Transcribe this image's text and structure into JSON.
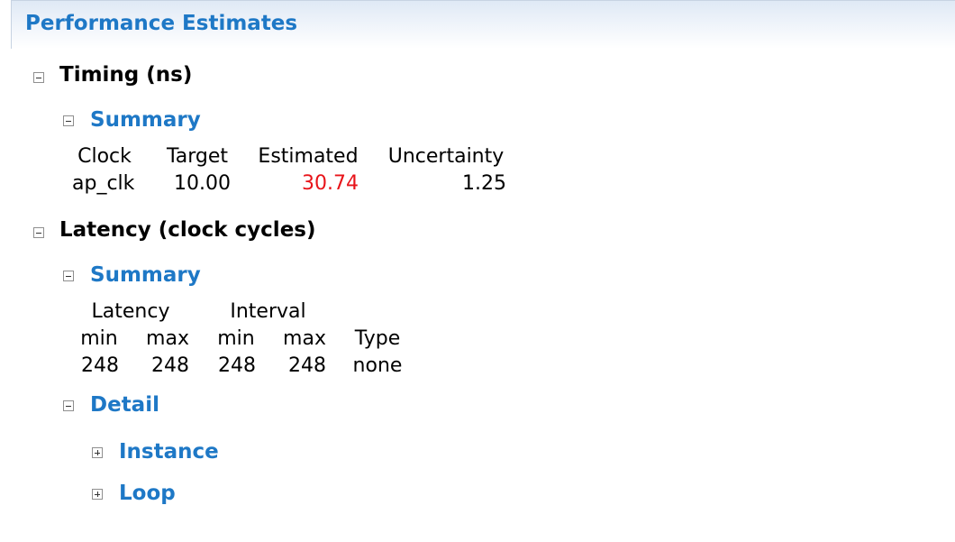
{
  "header": {
    "title": "Performance Estimates"
  },
  "timing": {
    "title": "Timing (ns)",
    "summary": {
      "title": "Summary",
      "columns": [
        "Clock",
        "Target",
        "Estimated",
        "Uncertainty"
      ],
      "row": {
        "clock": "ap_clk",
        "target": "10.00",
        "estimated": "30.74",
        "uncertainty": "1.25"
      }
    }
  },
  "latency": {
    "title": "Latency (clock cycles)",
    "summary": {
      "title": "Summary",
      "group_headers": {
        "latency": "Latency",
        "interval": "Interval"
      },
      "columns": [
        "min",
        "max",
        "min",
        "max",
        "Type"
      ],
      "row": [
        "248",
        "248",
        "248",
        "248",
        "none"
      ]
    },
    "detail": {
      "title": "Detail",
      "items": [
        {
          "label": "Instance"
        },
        {
          "label": "Loop"
        }
      ]
    }
  },
  "colors": {
    "accent": "#1e78c6",
    "warning": "#e8141a"
  }
}
